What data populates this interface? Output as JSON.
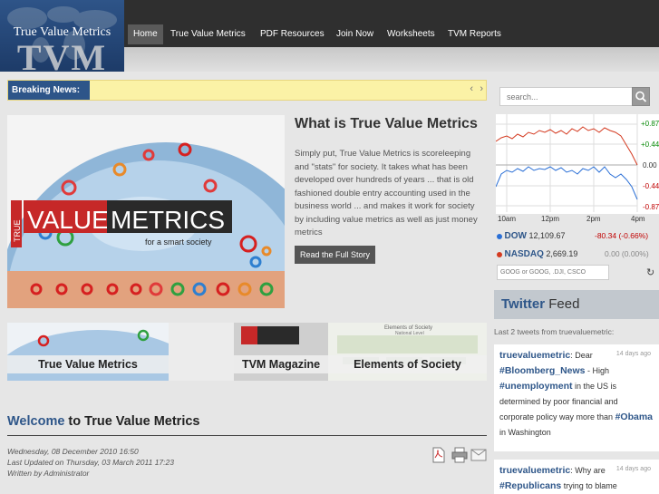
{
  "logo": {
    "title": "True Value Metrics",
    "mark": "TVM"
  },
  "nav": [
    "Home",
    "True Value Metrics",
    "PDF Resources",
    "Join Now",
    "Worksheets",
    "TVM Reports"
  ],
  "breaking": {
    "label": "Breaking News:",
    "prev": "‹",
    "next": "›"
  },
  "search": {
    "placeholder": "search..."
  },
  "hero": {
    "banner_prefix": "TRUE",
    "banner_value": "VALUE",
    "banner_metrics": "METRICS",
    "banner_tagline": "for a smart society",
    "title": "What is True Value Metrics",
    "text": "Simply put, True Value Metrics is scoreleeping and \"stats\" for society. It takes what has been developed over hundreds of years ... that is old fashioned double entry accounting used in the business world ... and makes it work for society by including value metrics as well as just money metrics",
    "button": "Read the Full Story"
  },
  "tiles": [
    "True Value Metrics",
    "TVM Magazine",
    "Elements of Society"
  ],
  "tile_decor": {
    "elements": "Elements of Society",
    "elements_sub": "National Level"
  },
  "welcome": {
    "lead": "Welcome",
    "rest": " to True Value Metrics"
  },
  "meta": {
    "created": "Wednesday, 08 December 2010 16:50",
    "updated": "Last Updated on Thursday, 03 March 2011 17:23",
    "author": "Written by Administrator"
  },
  "stocks": {
    "y_ticks": [
      "+0.87",
      "+0.44",
      "0.00",
      "-0.44",
      "-0.87"
    ],
    "x_ticks": [
      "10am",
      "12pm",
      "2pm",
      "4pm"
    ],
    "rows": [
      {
        "symbol": "DOW",
        "value": "12,109.67",
        "change": "-80.34 (-0.66%)",
        "dot": "#2a6fd6",
        "change_color": "#c00000"
      },
      {
        "symbol": "NASDAQ",
        "value": "2,669.19",
        "change": "0.00 (0.00%)",
        "dot": "#d43a20",
        "change_color": "#888888"
      }
    ],
    "input_placeholder": "GOOG or GOOG, .DJI, CSCO",
    "refresh": "↻"
  },
  "twitter": {
    "title_bold": "Twitter",
    "title_rest": " Feed",
    "subtitle": "Last 2 tweets from truevaluemetric:",
    "tweets": [
      {
        "user": "truevaluemetric",
        "after_user": ": Dear",
        "tag1": "#Bloomberg_News",
        "t1": " - High",
        "tag2": "#unemployment",
        "t2": " in the US is determined by poor financial and corporate policy way more than",
        "tag3": "#Obama",
        "t3": " in Washington",
        "date": "14 days ago"
      },
      {
        "user": "truevaluemetric",
        "after_user": ": Why are",
        "tag1": "#Republicans",
        "t1": " trying to blame",
        "date": "14 days ago"
      }
    ]
  },
  "colors": {
    "brand": "#2e5689",
    "nav_bg": "#2f2f2f",
    "breaking_bg": "#fbf2a6"
  }
}
